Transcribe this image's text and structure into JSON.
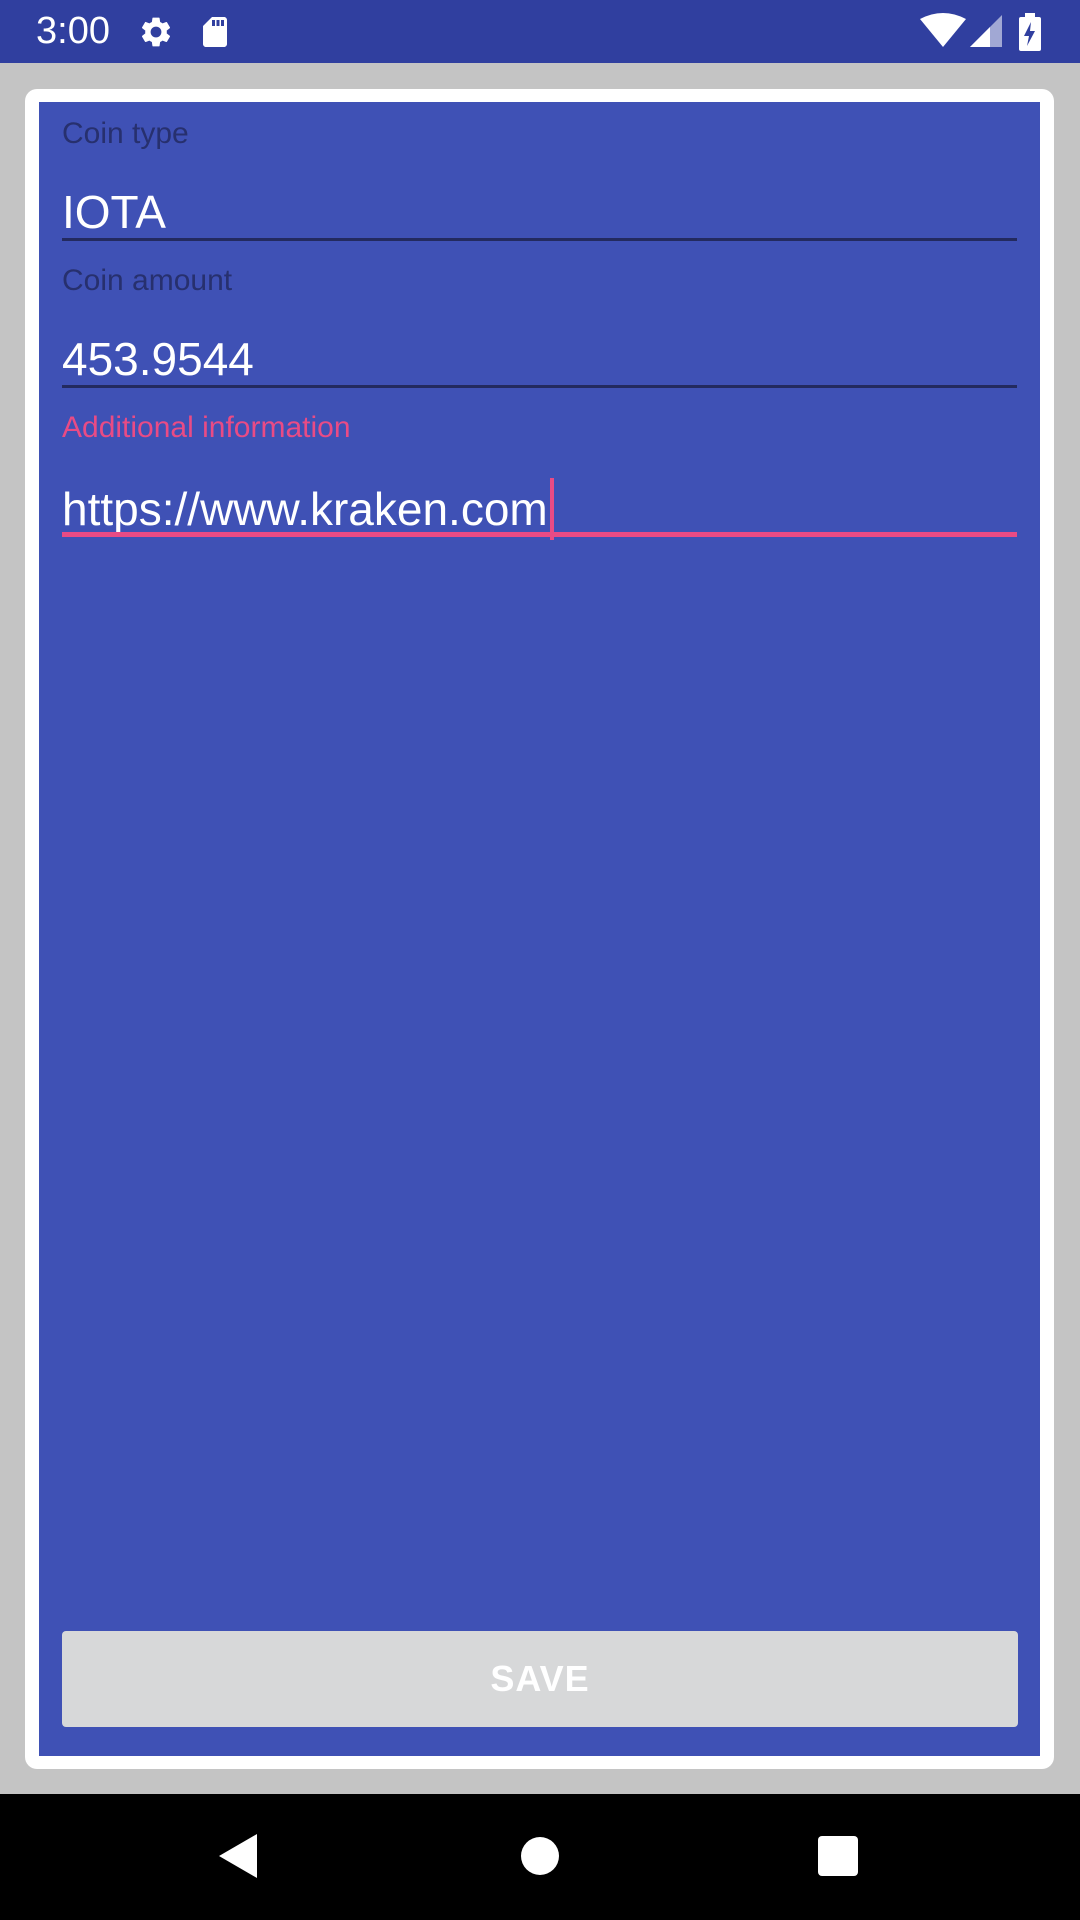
{
  "status_bar": {
    "time": "3:00",
    "left_icons": [
      "gear-icon",
      "sd-card-icon"
    ],
    "right_icons": [
      "wifi-icon",
      "signal-icon",
      "battery-charging-icon"
    ],
    "background": "#303f9f"
  },
  "form": {
    "panel_color": "#3f51b5",
    "accent_color": "#e94b85",
    "fields": [
      {
        "label": "Coin type",
        "value": "IOTA"
      },
      {
        "label": "Coin amount",
        "value": "453.9544"
      },
      {
        "label": "Additional information",
        "value": "https://www.kraken.com",
        "focused": true
      }
    ],
    "save_label": "SAVE"
  },
  "nav_bar": {
    "buttons": [
      "back-icon",
      "home-icon",
      "recents-icon"
    ]
  }
}
